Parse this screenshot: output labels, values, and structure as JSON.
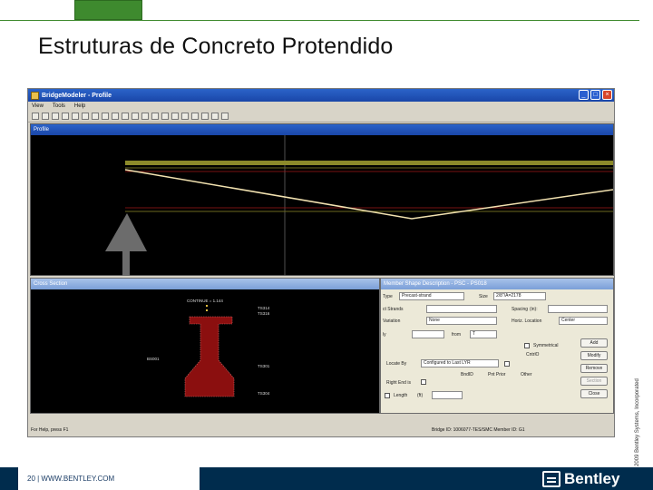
{
  "slide": {
    "title": "Estruturas de Concreto Protendido",
    "footer_text": "20 | WWW.BENTLEY.COM",
    "copyright": "© 2009 Bentley Systems, Incorporated",
    "logo_text": "Bentley"
  },
  "app": {
    "title": "BridgeModeler - Profile",
    "menu": [
      "View",
      "Tools",
      "Help"
    ],
    "window_buttons": [
      "_",
      "□",
      "×"
    ],
    "profile_title": "Profile",
    "cross_section_title": "Cross Section",
    "status_help": "For Help, press F1",
    "status_ids": "Bridge ID: 1006077-TES/SMC  Member ID: G1"
  },
  "cross_section": {
    "top_label": "CONTINUE = 1.144",
    "right_labels": [
      "TS314",
      "TS316",
      "TS301",
      "TS304"
    ],
    "left_label": "BS001"
  },
  "member_shape": {
    "title": "Member Shape Description - PSC - PS018",
    "type_label": "Type",
    "type_value": "Precast-strand",
    "size_label": "Size",
    "size_value": "2/8\"/A=2178",
    "strands_label": "ct Strands",
    "spacing_label": "Spacing",
    "spacing_unit": "(in):",
    "variation_label": "Variation",
    "variation_value": "None",
    "horiz_label": "Horiz. Location",
    "horiz_value": "Center",
    "ly_label": "ly",
    "from_label": "from",
    "from_value": "T",
    "symmetrical_label": "Symmetrical",
    "cntrl_label": "CntrlO",
    "locate_label": "Locate By",
    "locate_value": "Configured to Last LYR",
    "opt_labels": [
      "BndID",
      "Pnt Prior",
      "Other"
    ],
    "right_end_label": "Right End is",
    "length_label": "Length",
    "length_unit": "(ft)",
    "buttons": [
      "Add",
      "Modify",
      "Remove",
      "Section",
      "Close"
    ]
  },
  "colors": {
    "accent_green": "#3e8a2e",
    "footer_navy": "#002c4d",
    "window_blue": "#1a46a8",
    "girder_red": "#8b0f0f",
    "deck_olive": "#8c8a2a",
    "tendon_cream": "#f2e2b0"
  }
}
